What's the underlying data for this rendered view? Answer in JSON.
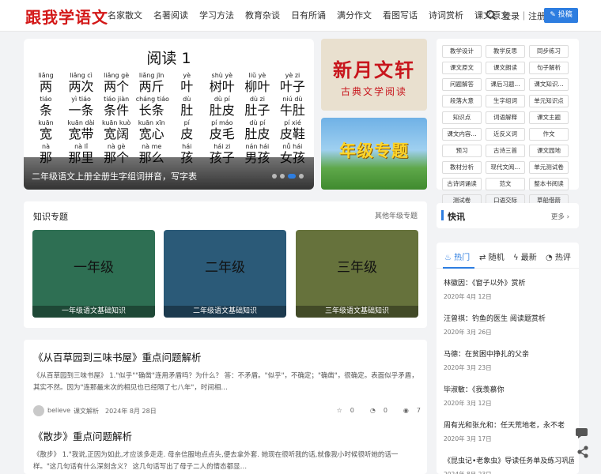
{
  "header": {
    "logo": "跟我学语文",
    "nav": [
      "名家散文",
      "名著阅读",
      "学习方法",
      "教育杂谈",
      "日有所诵",
      "满分作文",
      "看图写话",
      "诗词赏析",
      "课文原文"
    ],
    "login": "登录｜注册",
    "post_button": "投稿"
  },
  "hero": {
    "heading": "阅读 1",
    "rows": [
      [
        [
          "liǎng",
          "两"
        ],
        [
          "liǎng cì",
          "两次"
        ],
        [
          "liǎng gè",
          "两个"
        ],
        [
          "liǎng jīn",
          "两斤"
        ],
        [
          "yè",
          "叶"
        ],
        [
          "shù yè",
          "树叶"
        ],
        [
          "liǔ yè",
          "柳叶"
        ],
        [
          "yè zi",
          "叶子"
        ]
      ],
      [
        [
          "tiáo",
          "条"
        ],
        [
          "yì tiáo",
          "一条"
        ],
        [
          "tiáo jiàn",
          "条件"
        ],
        [
          "cháng tiáo",
          "长条"
        ],
        [
          "dù",
          "肚"
        ],
        [
          "dù pí",
          "肚皮"
        ],
        [
          "dù zi",
          "肚子"
        ],
        [
          "niú dù",
          "牛肚"
        ]
      ],
      [
        [
          "kuān",
          "宽"
        ],
        [
          "kuān dài",
          "宽带"
        ],
        [
          "kuān kuò",
          "宽阔"
        ],
        [
          "kuān xīn",
          "宽心"
        ],
        [
          "pí",
          "皮"
        ],
        [
          "pí máo",
          "皮毛"
        ],
        [
          "dù pí",
          "肚皮"
        ],
        [
          "pí xié",
          "皮鞋"
        ]
      ],
      [
        [
          "nà",
          "那"
        ],
        [
          "nà lǐ",
          "那里"
        ],
        [
          "nà gè",
          "那个"
        ],
        [
          "nà me",
          "那么"
        ],
        [
          "hái",
          "孩"
        ],
        [
          "hái zi",
          "孩子"
        ],
        [
          "nán hái",
          "男孩"
        ],
        [
          "nǚ hái",
          "女孩"
        ]
      ]
    ],
    "caption": "二年级语文上册全册生字组词拼音，写字表",
    "dots": [
      false,
      false,
      true,
      false
    ]
  },
  "promos": {
    "promo1_title": "新月文轩",
    "promo1_sub": "古典文学阅读",
    "promo2_title": "年级专题"
  },
  "categories": [
    "教学设计",
    "教学反思",
    "同步练习",
    "课文原文",
    "课文朗读",
    "句子解析",
    "问题解答",
    "课后习题...",
    "课文知识...",
    "段落大意",
    "生字组词",
    "单元知识点",
    "知识点",
    "词语解释",
    "课文主题",
    "课文内容...",
    "近反义词",
    "作文",
    "预习",
    "古诗三首",
    "课文园地",
    "教材分析",
    "现代文阅...",
    "单元测试卷",
    "古诗词诵读",
    "范文",
    "整本书阅读",
    "测试卷",
    "口语交际",
    "草船借箭"
  ],
  "topics": {
    "title": "知识专题",
    "more": "其他年级专题",
    "cards": [
      {
        "name": "一年级",
        "sub": "一年级语文基础知识"
      },
      {
        "name": "二年级",
        "sub": "二年级语文基础知识"
      },
      {
        "name": "三年级",
        "sub": "三年级语文基础知识"
      }
    ]
  },
  "articles": [
    {
      "title": "《从百草园到三味书屋》重点问题解析",
      "excerpt": "《从百草园到三味书屋》 1.\"似乎\"\"确凿\"连用矛盾吗？为什么？ 答：不矛盾。\"似乎\"，不确定；\"确凿\"，很确定。表面似乎矛盾，其实不然。因为\"连那最末次的相见也已经隔了七八年\"，时间相…",
      "author": "believe",
      "category": "课文解析",
      "date": "2024年 8月 28日",
      "likes": "0",
      "comments": "0",
      "views": "7"
    },
    {
      "title": "《散步》重点问题解析",
      "excerpt": "《散步》 1.\"我说,正因为如此,才应该多走走. 母亲信服地点点头,便去拿外套. 她现在很听我的话,就像我小时候很听她的话一样。\"这几句话有什么深刻含义？ 这几句话写出了母子二人的情态都显…",
      "author": "",
      "category": "",
      "date": "",
      "likes": "",
      "comments": "",
      "views": ""
    }
  ],
  "sidebar": {
    "flash_title": "快讯",
    "flash_more": "更多",
    "tabs": [
      "热门",
      "随机",
      "最新",
      "热评"
    ],
    "hot_items": [
      {
        "title": "林徽因：《窗子以外》赏析",
        "date": "2020年 4月 12日"
      },
      {
        "title": "汪曾祺：钓鱼的医生 阅读题赏析",
        "date": "2020年 3月 26日"
      },
      {
        "title": "马德：在贫困中挣扎的父亲",
        "date": "2020年 3月 23日"
      },
      {
        "title": "毕淑敏：《我羡慕你",
        "date": "2020年 3月 12日"
      },
      {
        "title": "周有光和张允和：任天荒地老，永不老",
        "date": "2020年 3月 17日"
      },
      {
        "title": "《昆虫记•老象虫》导读任务单及练习巩固",
        "date": "2024年 8月 23日"
      }
    ]
  },
  "colors": {
    "accent": "#2d7de0",
    "logo_red": "#d31818",
    "card1": "#2e6f53",
    "card2": "#2b5a78",
    "card3": "#66723c"
  }
}
